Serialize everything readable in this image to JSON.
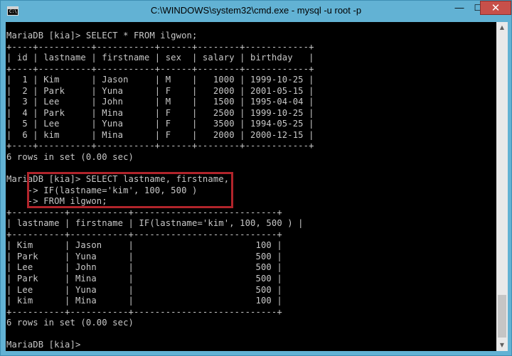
{
  "window": {
    "title": "C:\\WINDOWS\\system32\\cmd.exe - mysql  -u root -p",
    "icon_text": "C:\\",
    "minimize": "—",
    "maximize": "☐",
    "close": "✕",
    "icons": {
      "app": "cmd-icon",
      "close": "close-icon"
    },
    "colors": {
      "close": "#c7504a",
      "console_bg": "#000000",
      "console_text": "#c8c8c8",
      "highlight": "#b1242b"
    }
  },
  "console": {
    "lines": [
      "MariaDB [kia]> SELECT * FROM ilgwon;",
      "+----+----------+-----------+------+--------+------------+",
      "| id | lastname | firstname | sex  | salary | birthday   |",
      "+----+----------+-----------+------+--------+------------+",
      "|  1 | Kim      | Jason     | M    |   1000 | 1999-10-25 |",
      "|  2 | Park     | Yuna      | F    |   2000 | 2001-05-15 |",
      "|  3 | Lee      | John      | M    |   1500 | 1995-04-04 |",
      "|  4 | Park     | Mina      | F    |   2500 | 1999-10-25 |",
      "|  5 | Lee      | Yuna      | F    |   3500 | 1994-05-25 |",
      "|  6 | kim      | Mina      | F    |   2000 | 2000-12-15 |",
      "+----+----------+-----------+------+--------+------------+",
      "6 rows in set (0.00 sec)",
      "",
      "MariaDB [kia]> SELECT lastname, firstname,",
      "    -> IF(lastname='kim', 100, 500 )",
      "    -> FROM ilgwon;",
      "+----------+-----------+---------------------------+",
      "| lastname | firstname | IF(lastname='kim', 100, 500 ) |",
      "+----------+-----------+---------------------------+",
      "| Kim      | Jason     |                       100 |",
      "| Park     | Yuna      |                       500 |",
      "| Lee      | John      |                       500 |",
      "| Park     | Mina      |                       500 |",
      "| Lee      | Yuna      |                       500 |",
      "| kim      | Mina      |                       100 |",
      "+----------+-----------+---------------------------+",
      "6 rows in set (0.00 sec)",
      "",
      "MariaDB [kia]>"
    ]
  },
  "scrollbar": {
    "up": "▲",
    "down": "▼"
  }
}
